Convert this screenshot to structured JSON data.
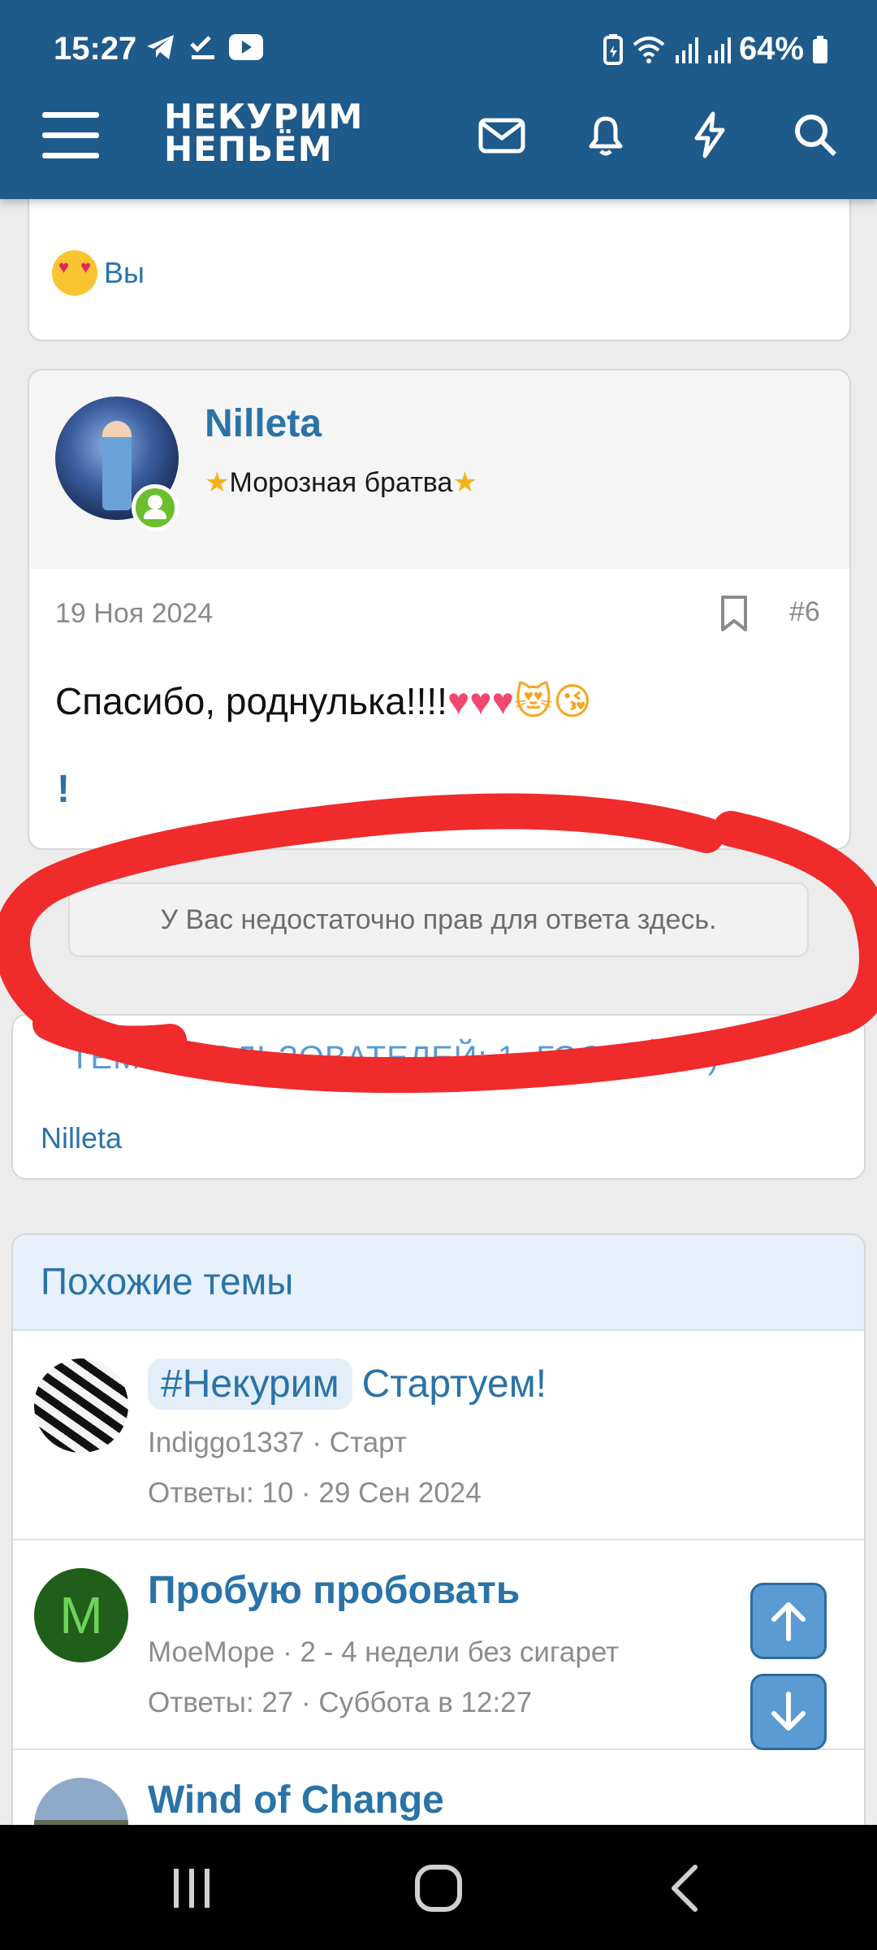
{
  "status_bar": {
    "time": "15:27",
    "battery": "64%"
  },
  "header": {
    "logo_line1": "НЕКУРИМ",
    "logo_line2": "НЕПЬЁМ"
  },
  "reaction": {
    "label": "Вы"
  },
  "post": {
    "username": "Nilleta",
    "user_title": "Морозная братва",
    "date": "19 Ноя 2024",
    "number": "#6",
    "text": "Спасибо, роднулька!!!!",
    "emoji_tail": "♥♥♥",
    "exclamation": "!"
  },
  "no_permission": "У Вас недостаточно прав для ответа здесь.",
  "users_in_thread": {
    "title": "ТЕМЕ (ПОЛЬЗОВАТЕЛЕЙ: 1, ГОСТЕЙ: 0)",
    "names": "Nilleta"
  },
  "similar_threads": {
    "heading": "Похожие темы",
    "items": [
      {
        "tag": "#Некурим",
        "title": "Стартуем!",
        "author_forum": "Indiggo1337 · Старт",
        "meta": "Ответы: 10 · 29 Сен 2024",
        "avatar_letter": ""
      },
      {
        "tag": "",
        "title": "Пробую пробовать",
        "author_forum": "МоеМоре · 2 - 4 недели без сигарет",
        "meta": "Ответы: 27 · Суббота в 12:27",
        "avatar_letter": "M"
      },
      {
        "tag": "",
        "title": "Wind of Change",
        "author_forum": "",
        "meta": "",
        "avatar_letter": ""
      }
    ]
  },
  "colors": {
    "header": "#1e5a8a",
    "link": "#2a73a8",
    "annotation": "#ef2b2b"
  }
}
